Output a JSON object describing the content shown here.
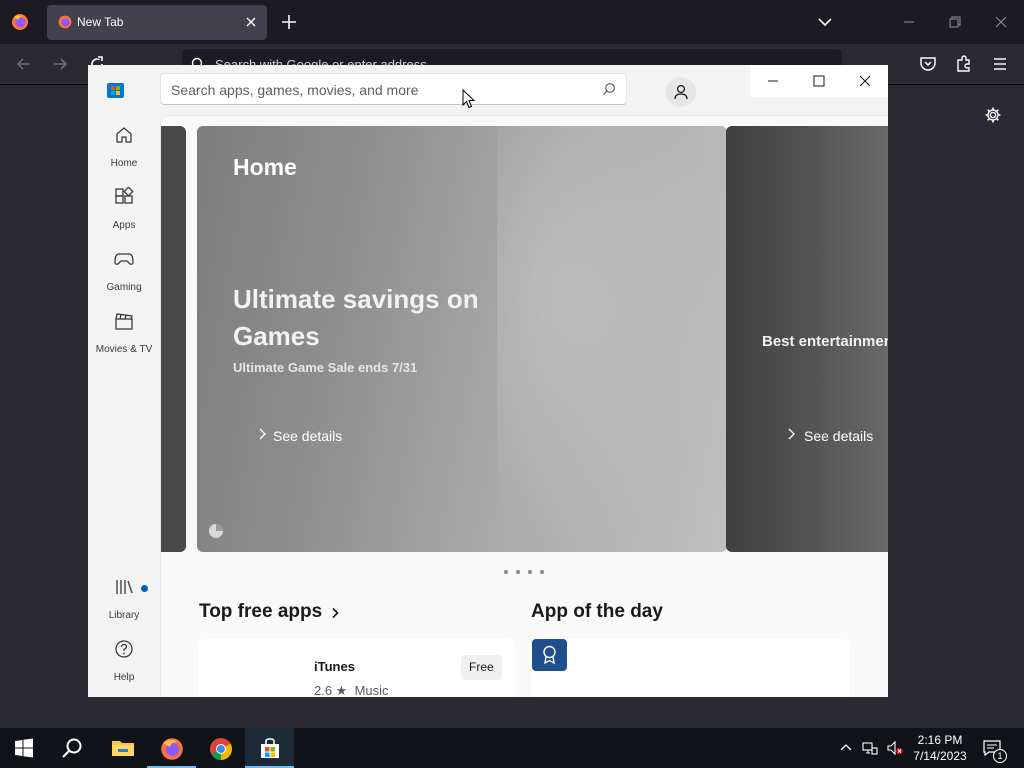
{
  "browser": {
    "tab_title": "New Tab",
    "url_placeholder": "Search with Google or enter address"
  },
  "store": {
    "search_placeholder": "Search apps, games, movies, and more",
    "nav": [
      {
        "label": "Home",
        "icon": "home-icon"
      },
      {
        "label": "Apps",
        "icon": "apps-icon"
      },
      {
        "label": "Gaming",
        "icon": "gamepad-icon"
      },
      {
        "label": "Movies & TV",
        "icon": "clapperboard-icon"
      }
    ],
    "nav_bottom": [
      {
        "label": "Library",
        "icon": "library-icon"
      },
      {
        "label": "Help",
        "icon": "help-icon"
      }
    ],
    "hero": {
      "page_title": "Home",
      "title": "Ultimate savings on Games",
      "subtitle": "Ultimate Game Sale ends 7/31",
      "details_label": "See details",
      "next_title": "Best entertainment apps",
      "next_details_label": "See details"
    },
    "pager_count": 4,
    "top_free": {
      "title": "Top free apps",
      "app": {
        "name": "iTunes",
        "rating": "2.6 ★",
        "category": "Music",
        "price": "Free"
      }
    },
    "app_of_day": {
      "title": "App of the day"
    }
  },
  "taskbar": {
    "time": "2:16 PM",
    "date": "7/14/2023",
    "notification_count": "1",
    "apps": [
      "windows-start",
      "search",
      "file-explorer",
      "firefox",
      "chrome",
      "microsoft-store"
    ]
  },
  "colors": {
    "accent": "#005fb8",
    "taskbar_highlight": "#76b9ed",
    "store_logo_blue": "#0078d4"
  }
}
